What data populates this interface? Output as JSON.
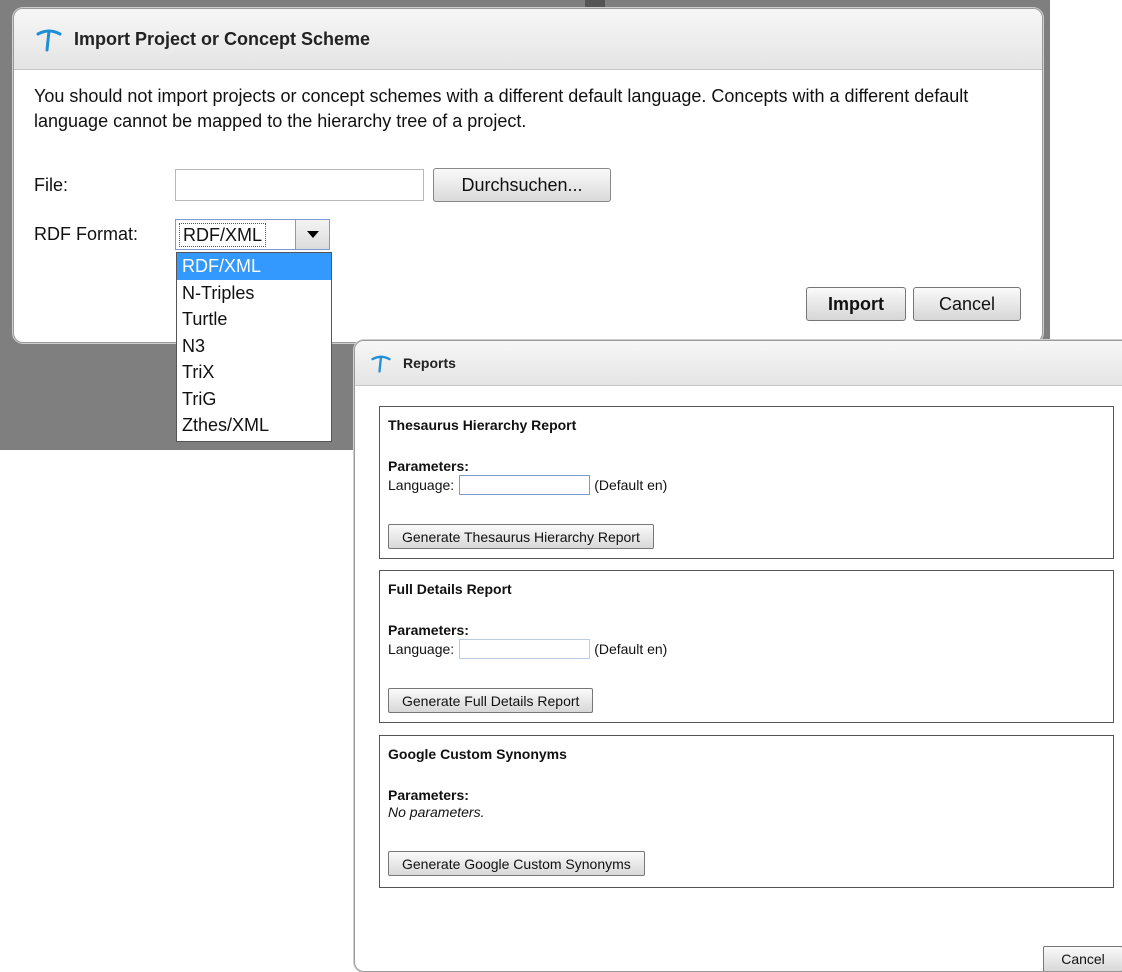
{
  "import_dialog": {
    "title": "Import Project or Concept Scheme",
    "message": "You should not import projects or concept schemes with a different default language. Concepts with a different default language cannot be mapped to the hierarchy tree of a project.",
    "file_label": "File:",
    "file_value": "",
    "browse_label": "Durchsuchen...",
    "format_label": "RDF Format:",
    "format_selected": "RDF/XML",
    "format_options": [
      "RDF/XML",
      "N-Triples",
      "Turtle",
      "N3",
      "TriX",
      "TriG",
      "Zthes/XML"
    ],
    "import_label": "Import",
    "cancel_label": "Cancel"
  },
  "reports_dialog": {
    "title": "Reports",
    "sections": [
      {
        "title": "Thesaurus Hierarchy Report",
        "params_label": "Parameters:",
        "language_label": "Language:",
        "language_value": "",
        "default_hint": "(Default en)",
        "button_label": "Generate Thesaurus Hierarchy Report"
      },
      {
        "title": "Full Details Report",
        "params_label": "Parameters:",
        "language_label": "Language:",
        "language_value": "",
        "default_hint": "(Default en)",
        "button_label": "Generate Full Details Report"
      },
      {
        "title": "Google Custom Synonyms",
        "params_label": "Parameters:",
        "no_params": "No parameters.",
        "button_label": "Generate Google Custom Synonyms"
      }
    ],
    "cancel_label": "Cancel"
  },
  "colors": {
    "logo": "#1f8fd6",
    "selection": "#3399ff"
  },
  "icons": {
    "logo": "pickaxe-logo-icon",
    "dropdown": "dropdown-arrow-icon"
  }
}
